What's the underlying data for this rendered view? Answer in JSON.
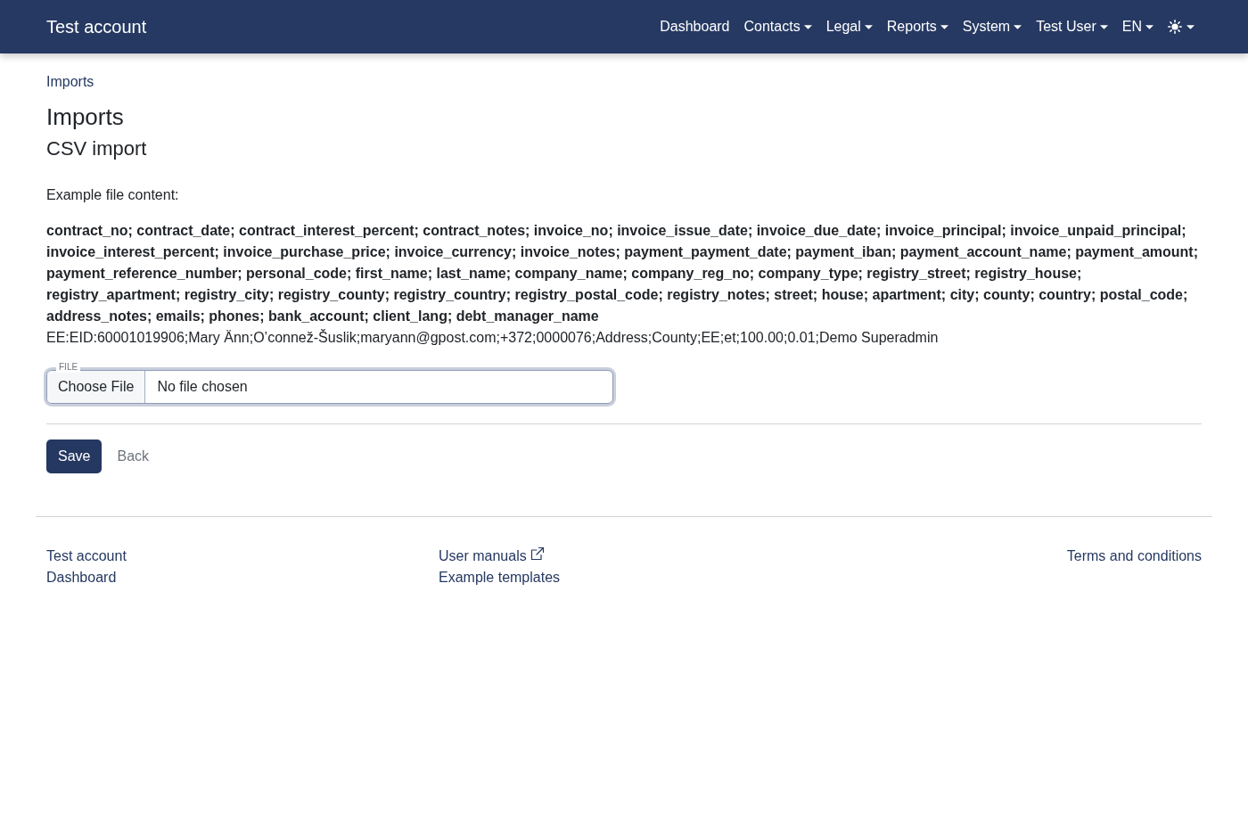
{
  "navbar": {
    "brand": "Test account",
    "items": [
      {
        "label": "Dashboard",
        "kind": "link"
      },
      {
        "label": "Contacts",
        "kind": "dropdown"
      },
      {
        "label": "Legal",
        "kind": "dropdown"
      },
      {
        "label": "Reports",
        "kind": "dropdown"
      },
      {
        "label": "System",
        "kind": "dropdown"
      },
      {
        "label": "Test User",
        "kind": "dropdown"
      },
      {
        "label": "EN",
        "kind": "dropdown"
      },
      {
        "kind": "theme"
      }
    ]
  },
  "breadcrumb": [
    {
      "label": "Imports"
    }
  ],
  "title": "Imports",
  "subtitle": "CSV import",
  "example": {
    "label": "Example file content:",
    "header": "contract_no; contract_date; contract_interest_percent; contract_notes; invoice_no; invoice_issue_date; invoice_due_date; invoice_principal; invoice_unpaid_principal; invoice_interest_percent; invoice_purchase_price; invoice_currency; invoice_notes; payment_payment_date; payment_iban; payment_account_name; payment_amount; payment_reference_number; personal_code; first_name; last_name; company_name; company_reg_no; company_type; registry_street; registry_house; registry_apartment; registry_city; registry_county; registry_country; registry_postal_code; registry_notes; street; house; apartment; city; county; country; postal_code; address_notes; emails; phones; bank_account; client_lang; debt_manager_name",
    "row": "EE:EID:60001019906;Mary Änn;O’connež-Šuslik;maryann@gpost.com;+372;0000076;Address;County;EE;et;100.00;0.01;Demo Superadmin"
  },
  "file_field": {
    "label": "FILE",
    "button": "Choose File",
    "status": "No file chosen"
  },
  "actions": [
    {
      "label": "Save",
      "kind": "primary"
    },
    {
      "label": "Back",
      "kind": "link"
    }
  ],
  "footer": {
    "columns": [
      {
        "links": [
          {
            "label": "Test account",
            "external": false
          },
          {
            "label": "Dashboard",
            "external": false
          }
        ]
      },
      {
        "links": [
          {
            "label": "User manuals",
            "external": true
          },
          {
            "label": "Example templates",
            "external": false
          }
        ]
      },
      {
        "links": [
          {
            "label": "Terms and conditions",
            "external": false
          }
        ]
      }
    ]
  }
}
